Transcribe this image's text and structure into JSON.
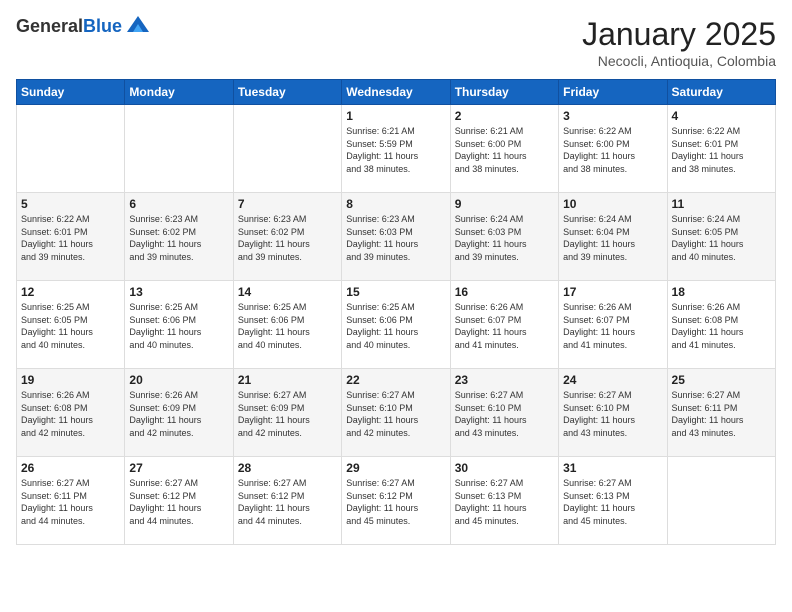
{
  "header": {
    "logo_general": "General",
    "logo_blue": "Blue",
    "month_title": "January 2025",
    "location": "Necocli, Antioquia, Colombia"
  },
  "weekdays": [
    "Sunday",
    "Monday",
    "Tuesday",
    "Wednesday",
    "Thursday",
    "Friday",
    "Saturday"
  ],
  "weeks": [
    [
      {
        "day": "",
        "info": ""
      },
      {
        "day": "",
        "info": ""
      },
      {
        "day": "",
        "info": ""
      },
      {
        "day": "1",
        "info": "Sunrise: 6:21 AM\nSunset: 5:59 PM\nDaylight: 11 hours\nand 38 minutes."
      },
      {
        "day": "2",
        "info": "Sunrise: 6:21 AM\nSunset: 6:00 PM\nDaylight: 11 hours\nand 38 minutes."
      },
      {
        "day": "3",
        "info": "Sunrise: 6:22 AM\nSunset: 6:00 PM\nDaylight: 11 hours\nand 38 minutes."
      },
      {
        "day": "4",
        "info": "Sunrise: 6:22 AM\nSunset: 6:01 PM\nDaylight: 11 hours\nand 38 minutes."
      }
    ],
    [
      {
        "day": "5",
        "info": "Sunrise: 6:22 AM\nSunset: 6:01 PM\nDaylight: 11 hours\nand 39 minutes."
      },
      {
        "day": "6",
        "info": "Sunrise: 6:23 AM\nSunset: 6:02 PM\nDaylight: 11 hours\nand 39 minutes."
      },
      {
        "day": "7",
        "info": "Sunrise: 6:23 AM\nSunset: 6:02 PM\nDaylight: 11 hours\nand 39 minutes."
      },
      {
        "day": "8",
        "info": "Sunrise: 6:23 AM\nSunset: 6:03 PM\nDaylight: 11 hours\nand 39 minutes."
      },
      {
        "day": "9",
        "info": "Sunrise: 6:24 AM\nSunset: 6:03 PM\nDaylight: 11 hours\nand 39 minutes."
      },
      {
        "day": "10",
        "info": "Sunrise: 6:24 AM\nSunset: 6:04 PM\nDaylight: 11 hours\nand 39 minutes."
      },
      {
        "day": "11",
        "info": "Sunrise: 6:24 AM\nSunset: 6:05 PM\nDaylight: 11 hours\nand 40 minutes."
      }
    ],
    [
      {
        "day": "12",
        "info": "Sunrise: 6:25 AM\nSunset: 6:05 PM\nDaylight: 11 hours\nand 40 minutes."
      },
      {
        "day": "13",
        "info": "Sunrise: 6:25 AM\nSunset: 6:06 PM\nDaylight: 11 hours\nand 40 minutes."
      },
      {
        "day": "14",
        "info": "Sunrise: 6:25 AM\nSunset: 6:06 PM\nDaylight: 11 hours\nand 40 minutes."
      },
      {
        "day": "15",
        "info": "Sunrise: 6:25 AM\nSunset: 6:06 PM\nDaylight: 11 hours\nand 40 minutes."
      },
      {
        "day": "16",
        "info": "Sunrise: 6:26 AM\nSunset: 6:07 PM\nDaylight: 11 hours\nand 41 minutes."
      },
      {
        "day": "17",
        "info": "Sunrise: 6:26 AM\nSunset: 6:07 PM\nDaylight: 11 hours\nand 41 minutes."
      },
      {
        "day": "18",
        "info": "Sunrise: 6:26 AM\nSunset: 6:08 PM\nDaylight: 11 hours\nand 41 minutes."
      }
    ],
    [
      {
        "day": "19",
        "info": "Sunrise: 6:26 AM\nSunset: 6:08 PM\nDaylight: 11 hours\nand 42 minutes."
      },
      {
        "day": "20",
        "info": "Sunrise: 6:26 AM\nSunset: 6:09 PM\nDaylight: 11 hours\nand 42 minutes."
      },
      {
        "day": "21",
        "info": "Sunrise: 6:27 AM\nSunset: 6:09 PM\nDaylight: 11 hours\nand 42 minutes."
      },
      {
        "day": "22",
        "info": "Sunrise: 6:27 AM\nSunset: 6:10 PM\nDaylight: 11 hours\nand 42 minutes."
      },
      {
        "day": "23",
        "info": "Sunrise: 6:27 AM\nSunset: 6:10 PM\nDaylight: 11 hours\nand 43 minutes."
      },
      {
        "day": "24",
        "info": "Sunrise: 6:27 AM\nSunset: 6:10 PM\nDaylight: 11 hours\nand 43 minutes."
      },
      {
        "day": "25",
        "info": "Sunrise: 6:27 AM\nSunset: 6:11 PM\nDaylight: 11 hours\nand 43 minutes."
      }
    ],
    [
      {
        "day": "26",
        "info": "Sunrise: 6:27 AM\nSunset: 6:11 PM\nDaylight: 11 hours\nand 44 minutes."
      },
      {
        "day": "27",
        "info": "Sunrise: 6:27 AM\nSunset: 6:12 PM\nDaylight: 11 hours\nand 44 minutes."
      },
      {
        "day": "28",
        "info": "Sunrise: 6:27 AM\nSunset: 6:12 PM\nDaylight: 11 hours\nand 44 minutes."
      },
      {
        "day": "29",
        "info": "Sunrise: 6:27 AM\nSunset: 6:12 PM\nDaylight: 11 hours\nand 45 minutes."
      },
      {
        "day": "30",
        "info": "Sunrise: 6:27 AM\nSunset: 6:13 PM\nDaylight: 11 hours\nand 45 minutes."
      },
      {
        "day": "31",
        "info": "Sunrise: 6:27 AM\nSunset: 6:13 PM\nDaylight: 11 hours\nand 45 minutes."
      },
      {
        "day": "",
        "info": ""
      }
    ]
  ]
}
